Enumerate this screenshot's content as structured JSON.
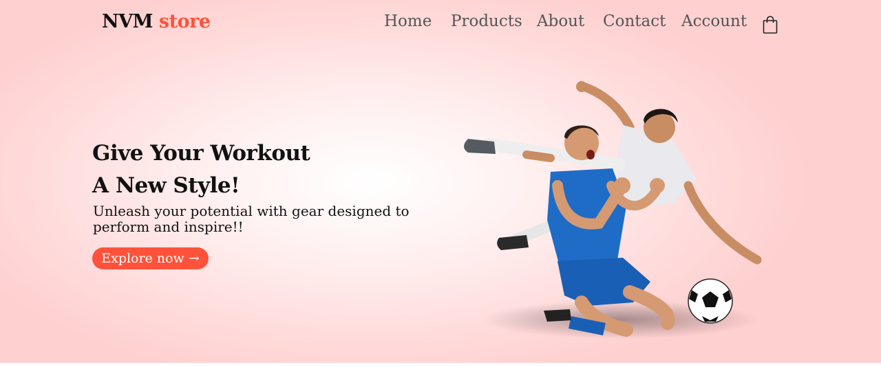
{
  "brand": {
    "name_primary": "NVM",
    "name_accent": "store",
    "accent_color": "#ff523b"
  },
  "nav": {
    "items": [
      "Home",
      "Products",
      "About",
      "Contact",
      "Account"
    ],
    "cart_icon": "shopping-bag-icon"
  },
  "hero": {
    "title_line1": "Give Your Workout",
    "title_line2": "A New Style!",
    "subtitle": "Unleash your potential with gear designed to perform and inspire!!",
    "cta_label": "Explore now →",
    "image": "soccer-players-illustration"
  },
  "colors": {
    "hero_bg_center": "#ffffff",
    "hero_bg_edge": "#ffd0d0",
    "text_dark": "#111111",
    "nav_text": "#555555"
  }
}
